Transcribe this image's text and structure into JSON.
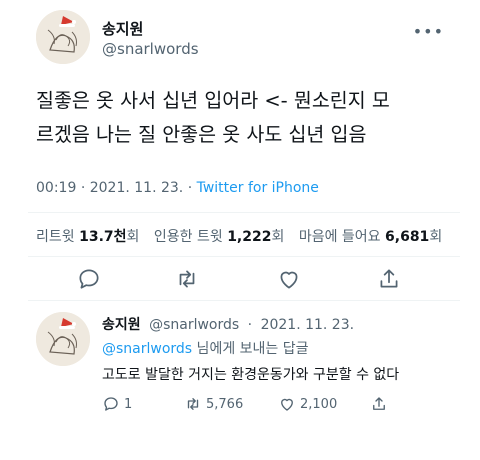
{
  "main_tweet": {
    "display_name": "송지원",
    "handle": "@snarlwords",
    "more_icon": "more-horizontal-icon",
    "text_lines": [
      "질좋은 옷 사서 십년 입어라 <- 뭔소린지 모",
      "르겠음 나는 질 안좋은 옷 사도 십년 입음"
    ],
    "time": "00:19",
    "date": "2021. 11. 23.",
    "separator": "·",
    "source": "Twitter for iPhone",
    "stats": {
      "retweets_label": "리트윗",
      "retweets_value": "13.7천",
      "retweets_unit": "회",
      "quotes_label": "인용한 트윗",
      "quotes_value": "1,222",
      "quotes_unit": "회",
      "likes_label": "마음에 들어요",
      "likes_value": "6,681",
      "likes_unit": "회"
    },
    "actions": [
      "reply-icon",
      "retweet-icon",
      "like-icon",
      "share-icon"
    ]
  },
  "reply_tweet": {
    "display_name": "송지원",
    "handle": "@snarlwords",
    "separator": "·",
    "date": "2021. 11. 23.",
    "replying_mention": "@snarlwords",
    "replying_suffix": " 님에게 보내는 답글",
    "text": "고도로 발달한 거지는 환경운동가와 구분할 수 없다",
    "reply_count": "1",
    "retweet_count": "5,766",
    "like_count": "2,100"
  },
  "colors": {
    "link": "#1d9bf0",
    "muted": "#536471",
    "text": "#0f1419",
    "divider": "#eff3f4"
  }
}
